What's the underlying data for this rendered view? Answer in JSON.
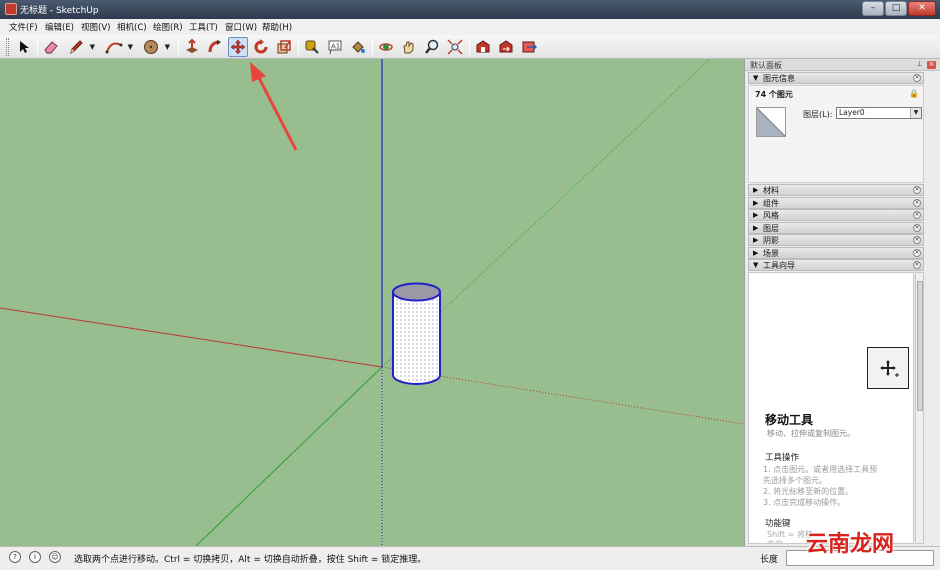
{
  "window": {
    "title": "无标题 - SketchUp",
    "controls": [
      "–",
      "□",
      "✕"
    ]
  },
  "menu": [
    "文件(F)",
    "编辑(E)",
    "视图(V)",
    "相机(C)",
    "绘图(R)",
    "工具(T)",
    "窗口(W)",
    "帮助(H)"
  ],
  "toolbar": {
    "active_tool": "move",
    "tools": [
      "select",
      "eraser",
      "pencil",
      "arc",
      "circle",
      "push-pull",
      "follow-me",
      "move",
      "rotate",
      "scale",
      "tape-measure",
      "text",
      "paint-bucket",
      "orbit",
      "pan",
      "zoom",
      "zoom-extents",
      "get-models",
      "share-model",
      "send-to-layout"
    ]
  },
  "tray": {
    "title": "默认面板",
    "entity_info": {
      "header": "图元信息",
      "count": "74 个图元",
      "layer_label": "图层(L):",
      "layer_value": "Layer0"
    },
    "sections": [
      "材料",
      "组件",
      "风格",
      "图层",
      "阴影",
      "场景",
      "工具向导"
    ],
    "instructor": {
      "title": "移动工具",
      "subtitle": "移动、拉伸或复制图元。",
      "operations_header": "工具操作",
      "operations": [
        "1.   点击图元。或者用选择工具预",
        "      先选择多个图元。",
        "2.   将光标移至新的位置。",
        "3.   点击完成移动操作。"
      ],
      "function_keys_header": "功能键",
      "function_keys_line1": "Shift = 将移",
      "function_keys_line2": "方向"
    }
  },
  "status": {
    "message": "选取两个点进行移动。Ctrl = 切换拷贝，Alt = 切换自动折叠，按住 Shift = 锁定推理。",
    "vcb_label": "长度",
    "vcb_value": ""
  },
  "watermark": "云南龙网",
  "colors": {
    "viewport_bg": "#98bd8f",
    "red_axis": "#b8393a",
    "green_axis": "#2fa02f",
    "blue_axis": "#2222c8",
    "annotation_arrow": "#e8453c"
  }
}
